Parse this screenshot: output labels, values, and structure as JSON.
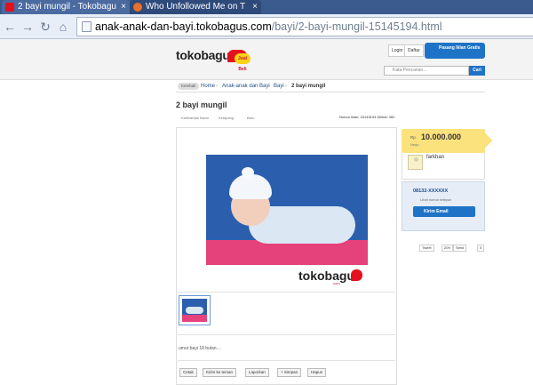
{
  "browser": {
    "tabs": [
      {
        "title": "2 bayi mungil - Tokobagu",
        "active": true
      },
      {
        "title": "Who Unfollowed Me on T",
        "active": false
      }
    ],
    "url_host": "anak-anak-dan-bayi.tokobagus.com",
    "url_path": "/bayi/2-bayi-mungil-15145194.html"
  },
  "header": {
    "logo_text": "tokobagus",
    "logo_sub": "Jual Beli",
    "login_label": "Login",
    "daftar_label": "Daftar",
    "pasang_label": "Pasang Iklan Gratis",
    "search_placeholder": "Kata Pencarian...",
    "search_button": "Cari"
  },
  "breadcrumb": {
    "back": "Kembali",
    "items": [
      "Home",
      "Anak-anak dan Bayi",
      "Bayi",
      "2 bayi mungil"
    ]
  },
  "listing": {
    "title": "2 bayi mungil",
    "meta": [
      "Kalimantan Barat",
      "Ketapang",
      "Baru"
    ],
    "ad_info": "Nomor iklan: 15145194   Dilihat: 382",
    "watermark": "tokobagus",
    "watermark_sub": ".com",
    "description": "umur bayi 18 bulan....",
    "actions": [
      "Cetak",
      "Kirim ke teman",
      "Laporkan",
      "+ Simpan",
      "Hapus"
    ]
  },
  "sidebar": {
    "currency": "Rp.",
    "price": "10.000.000",
    "negotiable": "Nego",
    "seller": "farkhan",
    "phone": "08132-XXXXXX",
    "phone_hint": "Lihat nomor telepon",
    "email_button": "Kirim Email",
    "share": [
      "Tweet",
      "209",
      "Send",
      "0"
    ]
  },
  "colors": {
    "browser_frame": "#3b5a8e",
    "brand_blue": "#1e73c7",
    "brand_red": "#c8102e",
    "price_yellow": "#fbe27c"
  }
}
